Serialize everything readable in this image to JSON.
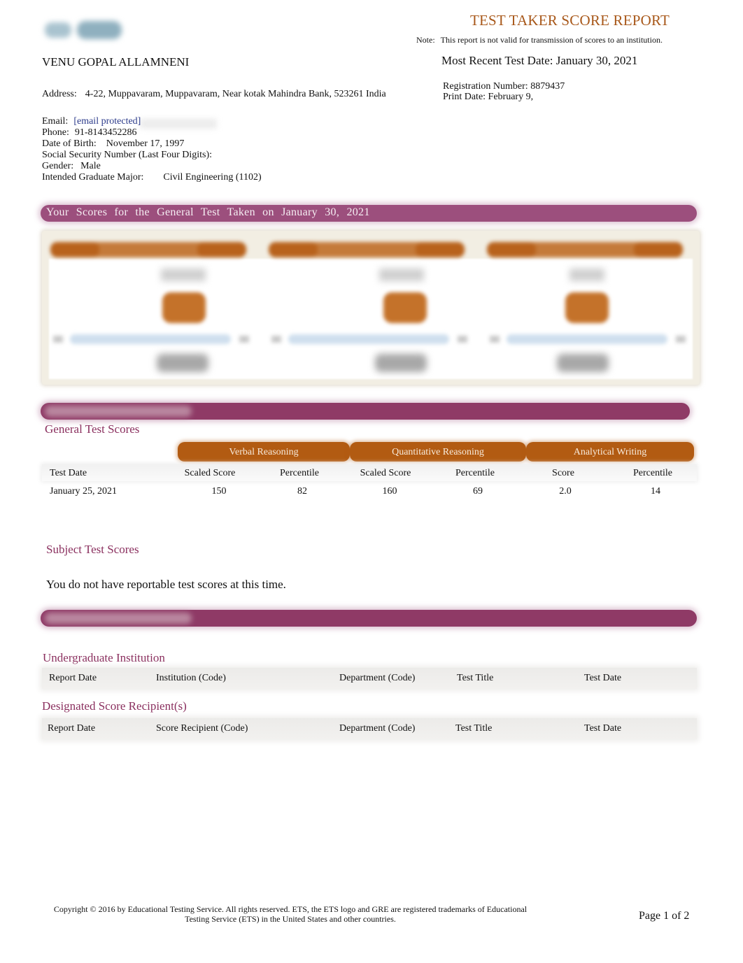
{
  "header": {
    "title": "TEST TAKER SCORE REPORT",
    "note_label": "Note:",
    "note_text": "This report is not valid for transmission of scores to an institution.",
    "most_recent_test_date": "Most Recent Test Date: January 30, 2021",
    "registration_number": "Registration Number: 8879437",
    "print_date": "Print Date: February 9,"
  },
  "candidate": {
    "name": "VENU GOPAL ALLAMNENI",
    "address_label": "Address:",
    "address": "4-22, Muppavaram, Muppavaram, Near kotak Mahindra Bank, 523261 India",
    "email_label": "Email:",
    "email": "[email protected]",
    "phone_label": "Phone:",
    "phone": "91-8143452286",
    "dob_label": "Date of Birth:",
    "dob": "November 17, 1997",
    "ssn_label": "Social Security Number (Last Four Digits):",
    "gender_label": "Gender:",
    "gender": "Male",
    "major_label": "Intended Graduate Major:",
    "major": "Civil Engineering (1102)"
  },
  "scores_banner": "Your Scores for the General Test Taken on January 30, 2021",
  "general_test": {
    "heading": "General Test Scores",
    "groups": [
      "Verbal Reasoning",
      "Quantitative Reasoning",
      "Analytical Writing"
    ],
    "columns": [
      "Test Date",
      "Scaled Score",
      "Percentile",
      "Scaled Score",
      "Percentile",
      "Score",
      "Percentile"
    ],
    "rows": [
      [
        "January 25, 2021",
        "150",
        "82",
        "160",
        "69",
        "2.0",
        "14"
      ]
    ]
  },
  "subject_test": {
    "heading": "Subject Test Scores",
    "message": "You do not have reportable test scores at this time."
  },
  "undergraduate": {
    "heading": "Undergraduate Institution",
    "columns": [
      "Report Date",
      "Institution (Code)",
      "Department (Code)",
      "Test Title",
      "Test Date"
    ]
  },
  "recipients": {
    "heading": "Designated Score Recipient(s)",
    "columns": [
      "Report Date",
      "Score Recipient (Code)",
      "Department (Code)",
      "Test Title",
      "Test Date"
    ]
  },
  "footer": {
    "copyright_line1": "Copyright © 2016 by Educational Testing Service. All rights reserved. ETS, the ETS logo and GRE are registered trademarks of Educational",
    "copyright_line2": "Testing Service (ETS) in the United States and other countries.",
    "page": "Page 1 of 2"
  }
}
